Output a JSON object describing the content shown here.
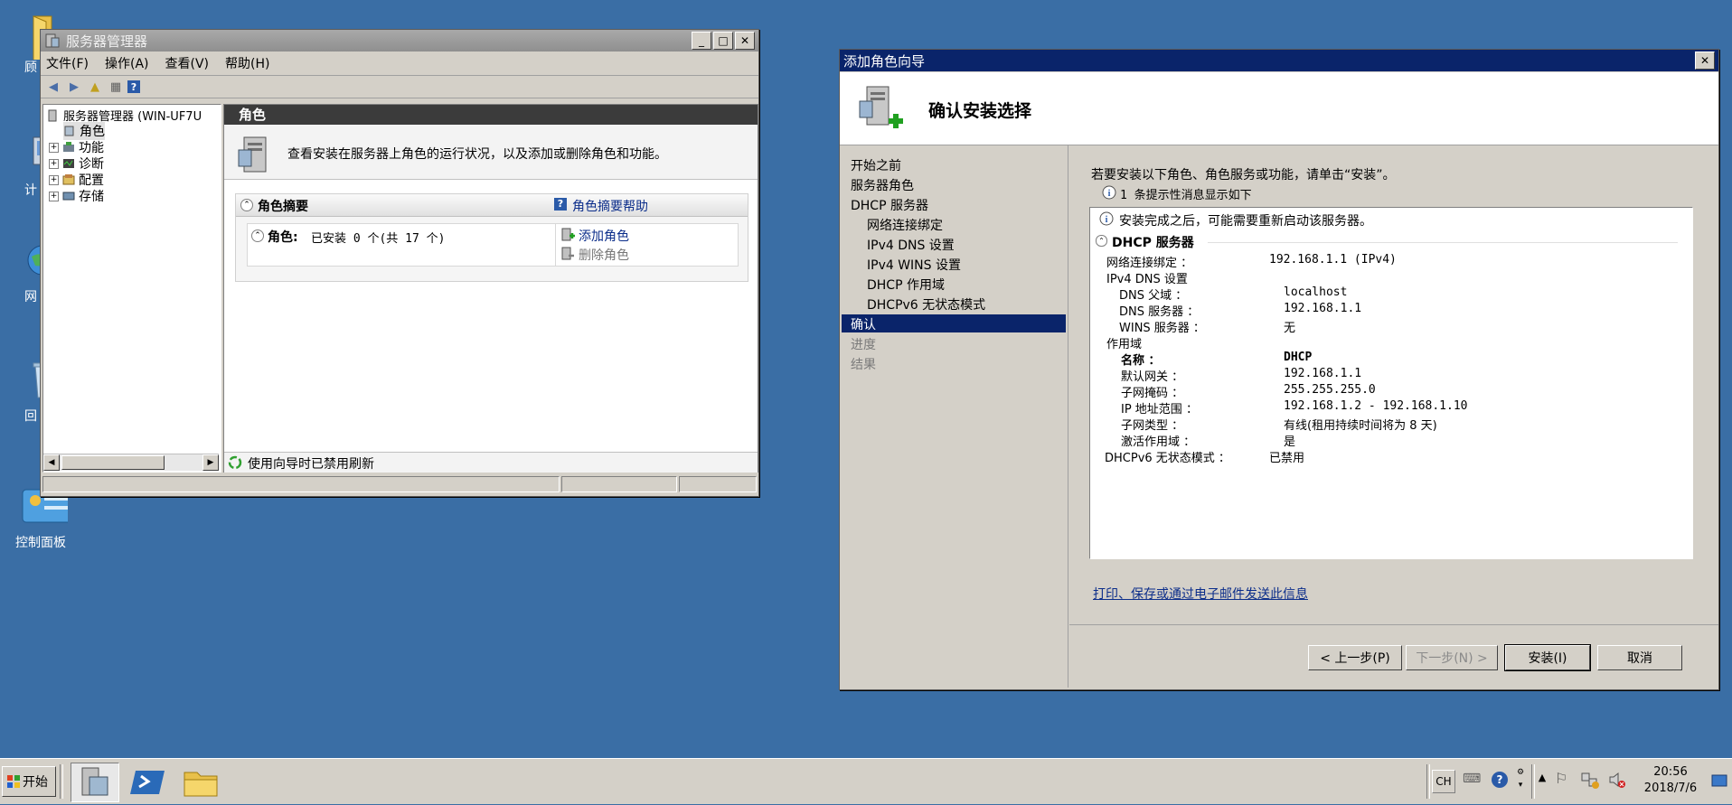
{
  "desktop": {
    "icons": [
      {
        "label": "顾",
        "icon": "folder-icon"
      },
      {
        "label": "计",
        "icon": "computer-icon"
      },
      {
        "label": "网",
        "icon": "network-icon"
      },
      {
        "label": "回",
        "icon": "recycle-bin-icon"
      },
      {
        "label": "控制面板",
        "icon": "control-panel-icon"
      }
    ]
  },
  "server_manager": {
    "title": "服务器管理器",
    "menu": [
      "文件(F)",
      "操作(A)",
      "查看(V)",
      "帮助(H)"
    ],
    "tree": {
      "root": "服务器管理器 (WIN-UF7U",
      "items": [
        "角色",
        "功能",
        "诊断",
        "配置",
        "存储"
      ]
    },
    "content_header": "角色",
    "description": "查看安装在服务器上角色的运行状况，以及添加或删除角色和功能。",
    "summary_title": "角色摘要",
    "summary_help": "角色摘要帮助",
    "roles_status": "角色: 已安装 0 个(共 17 个)",
    "roles_label": "角色:",
    "roles_value": "已安装 0 个(共 17 个)",
    "add_role": "添加角色",
    "remove_role": "删除角色",
    "status_text": "使用向导时已禁用刷新"
  },
  "wizard": {
    "title": "添加角色向导",
    "heading": "确认安装选择",
    "nav": [
      {
        "label": "开始之前",
        "state": "normal"
      },
      {
        "label": "服务器角色",
        "state": "normal"
      },
      {
        "label": "DHCP 服务器",
        "state": "normal"
      },
      {
        "label": "网络连接绑定",
        "state": "sub"
      },
      {
        "label": "IPv4 DNS 设置",
        "state": "sub"
      },
      {
        "label": "IPv4 WINS 设置",
        "state": "sub"
      },
      {
        "label": "DHCP 作用域",
        "state": "sub"
      },
      {
        "label": "DHCPv6 无状态模式",
        "state": "sub"
      },
      {
        "label": "确认",
        "state": "selected"
      },
      {
        "label": "进度",
        "state": "disabled"
      },
      {
        "label": "结果",
        "state": "disabled"
      }
    ],
    "instruction": "若要安装以下角色、角色服务或功能，请单击“安装”。",
    "info_count": "1 条提示性消息显示如下",
    "restart_notice": "安装完成之后，可能需要重新启动该服务器。",
    "section_title": "DHCP 服务器",
    "details": [
      {
        "label": "网络连接绑定 ：",
        "value": "192.168.1.1 (IPv4)",
        "indent": 0,
        "bold": false
      },
      {
        "label": "IPv4 DNS 设置",
        "value": "",
        "indent": 0,
        "bold": false
      },
      {
        "label": "DNS 父域 ：",
        "value": "localhost",
        "indent": 1,
        "bold": false
      },
      {
        "label": "DNS 服务器 ：",
        "value": "192.168.1.1",
        "indent": 1,
        "bold": false
      },
      {
        "label": "WINS 服务器 ：",
        "value": "无",
        "indent": 1,
        "bold": false
      },
      {
        "label": "作用域",
        "value": "",
        "indent": 0,
        "bold": false
      },
      {
        "label": "名称 ：",
        "value": "DHCP",
        "indent": 1,
        "bold": true
      },
      {
        "label": "默认网关 ：",
        "value": "192.168.1.1",
        "indent": 1,
        "bold": false
      },
      {
        "label": "子网掩码 ：",
        "value": "255.255.255.0",
        "indent": 1,
        "bold": false
      },
      {
        "label": "IP 地址范围 ：",
        "value": "192.168.1.2 - 192.168.1.10",
        "indent": 1,
        "bold": false
      },
      {
        "label": "子网类型 ：",
        "value": "有线(租用持续时间将为 8 天)",
        "indent": 1,
        "bold": false
      },
      {
        "label": "激活作用域 ：",
        "value": "是",
        "indent": 1,
        "bold": false
      },
      {
        "label": "DHCPv6 无状态模式 ：",
        "value": "已禁用",
        "indent": 0,
        "bold": false
      }
    ],
    "link": "打印、保存或通过电子邮件发送此信息",
    "buttons": {
      "back": "< 上一步(P)",
      "next": "下一步(N) >",
      "install": "安装(I)",
      "cancel": "取消"
    }
  },
  "taskbar": {
    "start": "开始",
    "lang": "CH",
    "time": "20:56",
    "date": "2018/7/6"
  }
}
